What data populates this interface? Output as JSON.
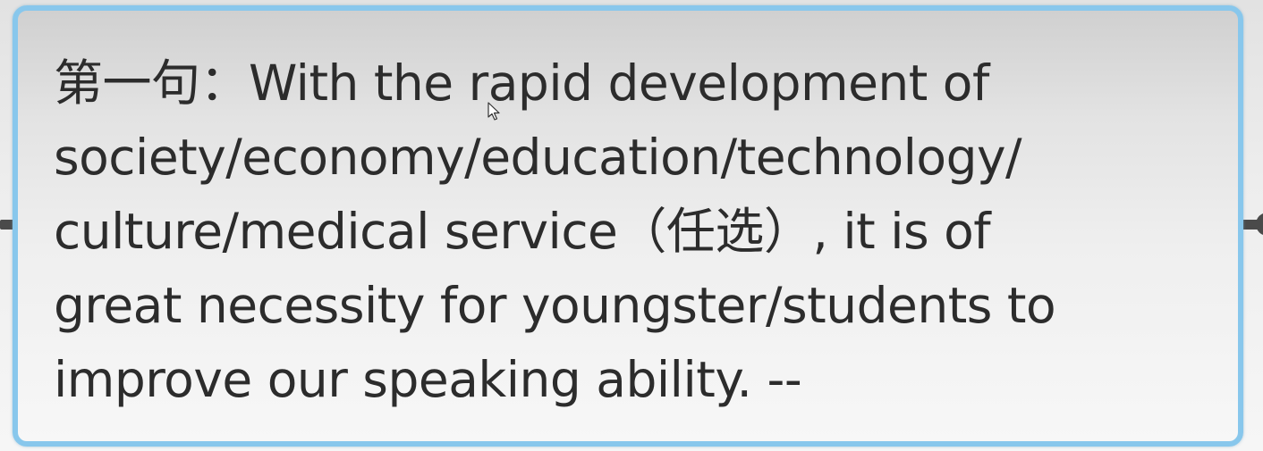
{
  "node": {
    "lines": [
      "第一句：With the rapid development of",
      "society/economy/education/technology/",
      "culture/medical service（任选）, it is of",
      "great necessity for youngster/students to",
      "improve our speaking ability. --"
    ]
  },
  "colors": {
    "border": "#88c7ec",
    "text": "#2c2c2c",
    "connector": "#4a4a4a"
  },
  "icons": {
    "cursor": "mouse-pointer"
  }
}
